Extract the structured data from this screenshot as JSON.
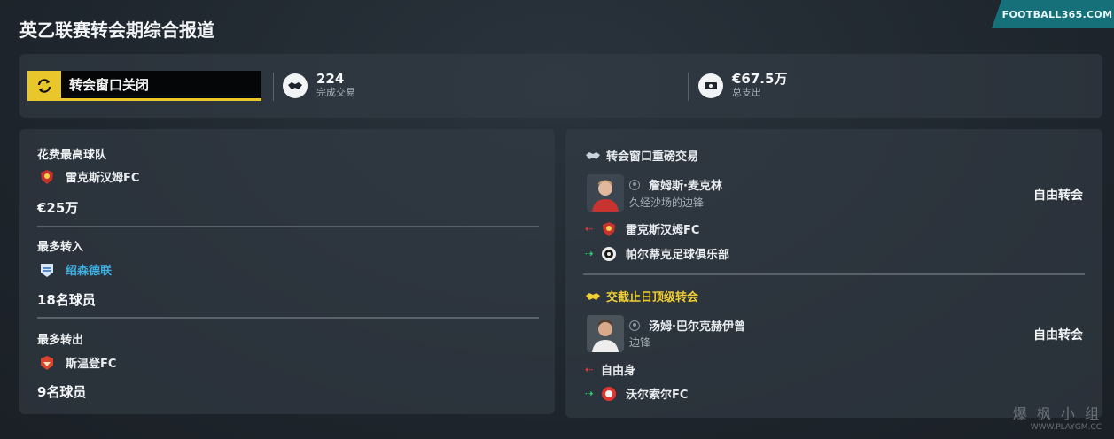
{
  "header": {
    "title": "英乙联赛转会期综合报道",
    "brand": "FOOTBALL365.COM"
  },
  "summary": {
    "window_status": "转会窗口关闭",
    "deals": {
      "value": "224",
      "caption": "完成交易"
    },
    "spend": {
      "value": "€67.5万",
      "caption": "总支出"
    }
  },
  "left": {
    "top_spender": {
      "label": "花费最高球队",
      "club": "雷克斯汉姆FC",
      "value": "€25万"
    },
    "most_in": {
      "label": "最多转入",
      "club": "绍森德联",
      "value": "18名球员"
    },
    "most_out": {
      "label": "最多转出",
      "club": "斯温登FC",
      "value": "9名球员"
    }
  },
  "right": {
    "big_deal": {
      "heading": "转会窗口重磅交易",
      "player": "詹姆斯·麦克林",
      "role": "久经沙场的边锋",
      "fee": "自由转会",
      "from": "雷克斯汉姆FC",
      "to": "帕尔蒂克足球俱乐部"
    },
    "deadline_deal": {
      "heading": "交截止日顶级转会",
      "player": "汤姆·巴尔克赫伊曾",
      "role": "边锋",
      "fee": "自由转会",
      "from": "自由身",
      "to": "沃尔索尔FC"
    }
  },
  "watermark": {
    "line1": "爆 枫 小 组",
    "line2": "WWW.PLAYGM.CC"
  },
  "colors": {
    "accent_yellow": "#e9c62b",
    "link_blue": "#3fb2e3",
    "brand_teal": "#15707a"
  }
}
